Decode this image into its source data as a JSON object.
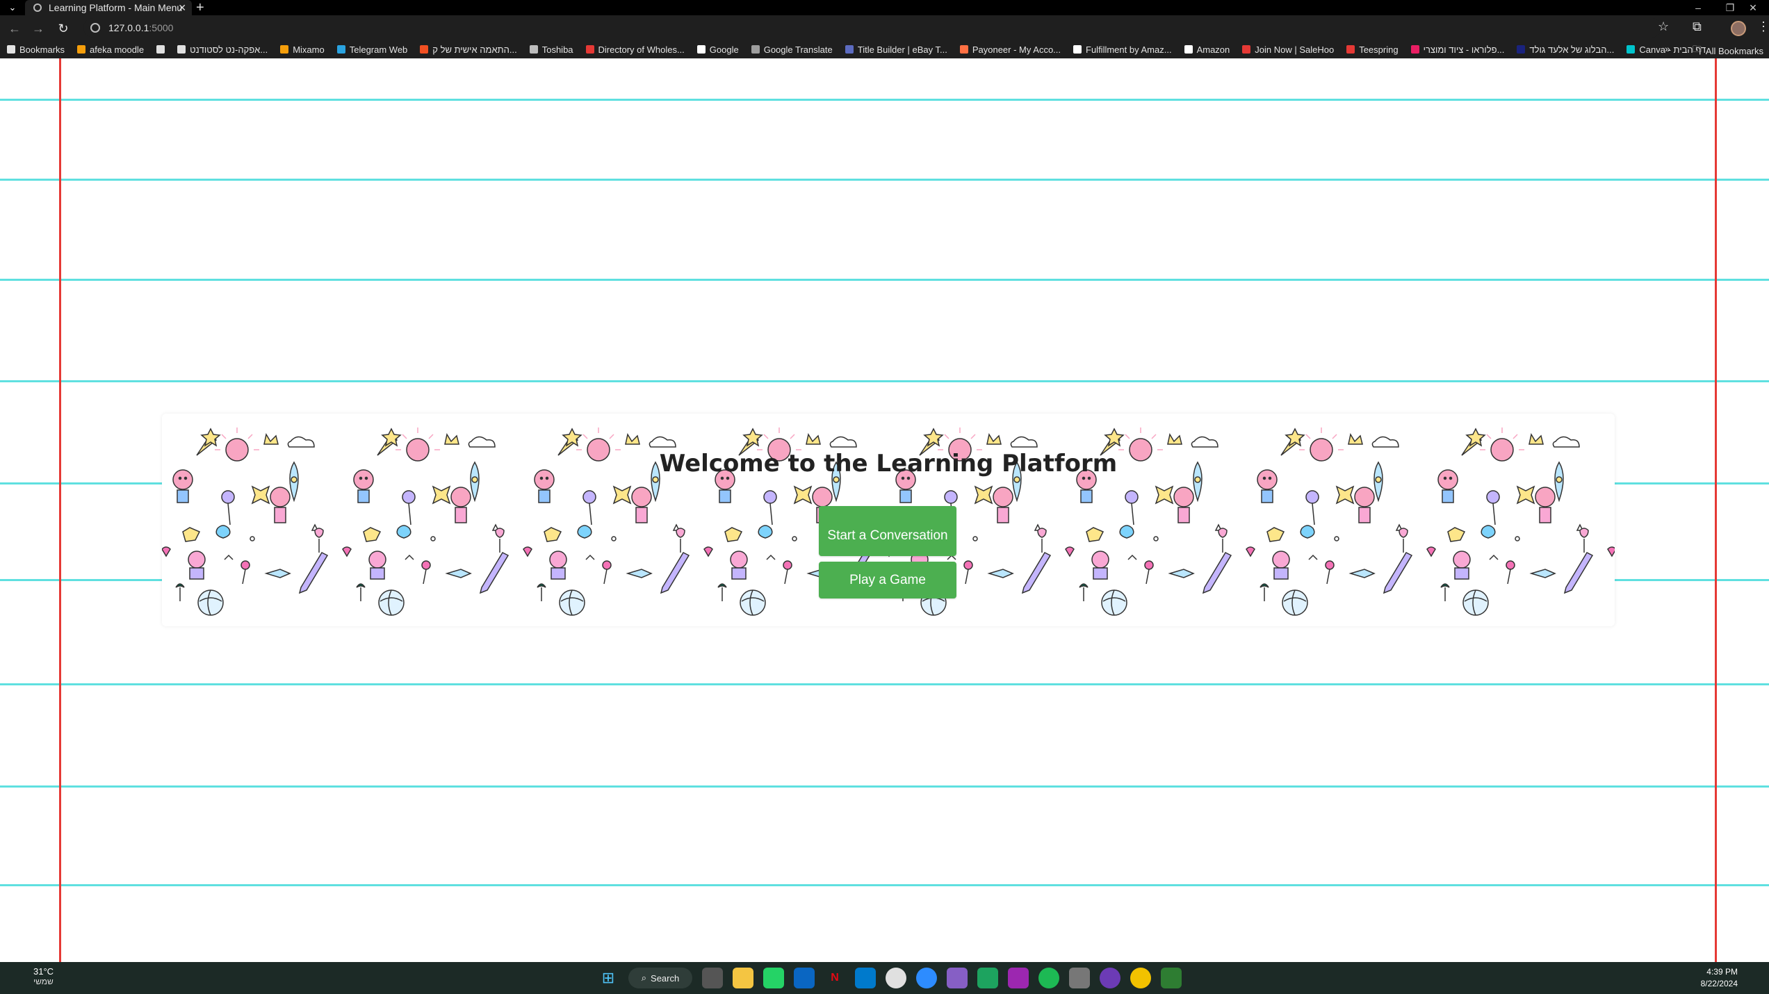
{
  "browser": {
    "tab_title": "Learning Platform - Main Menu",
    "url_host": "127.0.0.1",
    "url_port": ":5000",
    "bookmarks": [
      {
        "label": "Bookmarks",
        "icon": "star-icon",
        "color": "#e3e3e3"
      },
      {
        "label": "afeka moodle",
        "icon": "moodle-icon",
        "color": "#f59e0b"
      },
      {
        "label": "",
        "icon": "office-icon",
        "color": "#e0e0e0"
      },
      {
        "label": "אפקה-נט לסטודנט...",
        "icon": "afeka-icon",
        "color": "#e0e0e0"
      },
      {
        "label": "Mixamo",
        "icon": "mixamo-icon",
        "color": "#f59e0b"
      },
      {
        "label": "Telegram Web",
        "icon": "telegram-icon",
        "color": "#2aa3e0"
      },
      {
        "label": "התאמה אישית של ק...",
        "icon": "microsoft-icon",
        "color": "#f25022"
      },
      {
        "label": "Toshiba",
        "icon": "folder-icon",
        "color": "#bdbdbd"
      },
      {
        "label": "Directory of Wholes...",
        "icon": "salehoo-icon",
        "color": "#e53935"
      },
      {
        "label": "Google",
        "icon": "google-icon",
        "color": "#ffffff"
      },
      {
        "label": "Google Translate",
        "icon": "translate-icon",
        "color": "#9e9e9e"
      },
      {
        "label": "Title Builder | eBay T...",
        "icon": "ebay-icon",
        "color": "#5c6bc0"
      },
      {
        "label": "Payoneer - My Acco...",
        "icon": "payoneer-icon",
        "color": "#ff7043"
      },
      {
        "label": "Fulfillment by Amaz...",
        "icon": "amazon-icon",
        "color": "#ffffff"
      },
      {
        "label": "Amazon",
        "icon": "amazon-icon",
        "color": "#ffffff"
      },
      {
        "label": "Join Now | SaleHoo",
        "icon": "salehoo-icon",
        "color": "#e53935"
      },
      {
        "label": "Teespring",
        "icon": "teespring-icon",
        "color": "#e53935"
      },
      {
        "label": "פלוראו - ציוד ומוצרי...",
        "icon": "floraw-icon",
        "color": "#e91e63"
      },
      {
        "label": "הבלוג של אלעד גולד...",
        "icon": "blog-icon",
        "color": "#1a237e"
      },
      {
        "label": "Canva - דף הבית",
        "icon": "canva-icon",
        "color": "#00c4cc"
      }
    ],
    "all_bookmarks": "All Bookmarks"
  },
  "page": {
    "title": "Welcome to the Learning Platform",
    "start_conversation": "Start a Conversation",
    "play_game": "Play a Game",
    "colors": {
      "ruled_line": "#5fe0e0",
      "margin_line": "#e53935",
      "button": "#4caf50"
    }
  },
  "taskbar": {
    "temperature": "31°C",
    "weather_desc": "שמשי",
    "search_label": "Search",
    "time": "4:39 PM",
    "date": "8/22/2024"
  }
}
